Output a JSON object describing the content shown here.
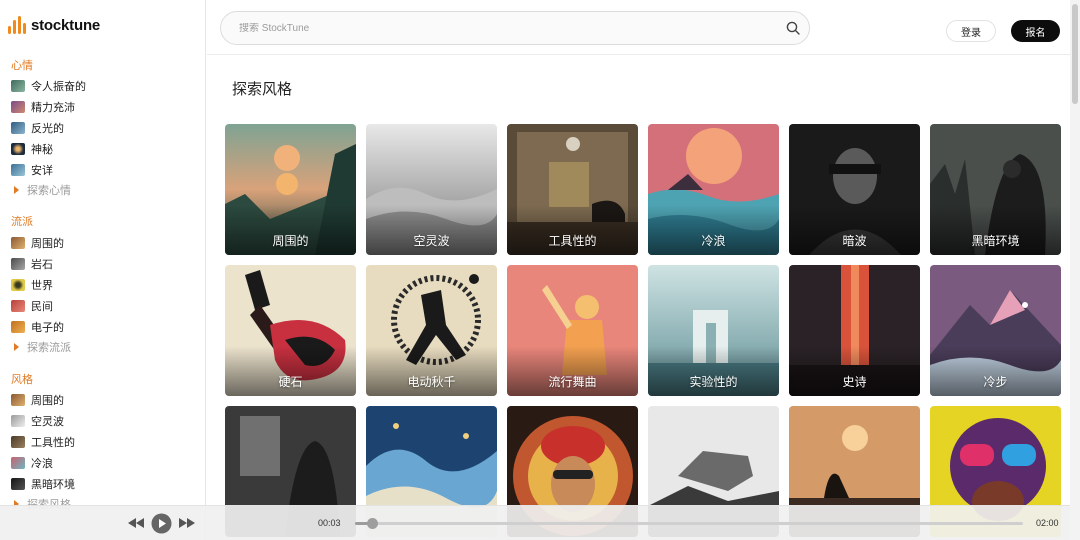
{
  "app": {
    "brand": "stocktune"
  },
  "sidebar": {
    "sections": [
      {
        "title": "心情",
        "items": [
          {
            "label": "令人振奋的",
            "thumb": "#5c8a7a"
          },
          {
            "label": "精力充沛",
            "thumb": "#b06c7c"
          },
          {
            "label": "反光的",
            "thumb": "#4f7c9c"
          },
          {
            "label": "神秘",
            "thumb": "#2b3c53"
          },
          {
            "label": "安详",
            "thumb": "#5d8dab"
          }
        ],
        "explore": "探索心情"
      },
      {
        "title": "流派",
        "items": [
          {
            "label": "周围的",
            "thumb": "#a7794e"
          },
          {
            "label": "岩石",
            "thumb": "#6f6f6f"
          },
          {
            "label": "世界",
            "thumb": "#c9b13a"
          },
          {
            "label": "民间",
            "thumb": "#c8504a"
          },
          {
            "label": "电子的",
            "thumb": "#d38a2e"
          }
        ],
        "explore": "探索流派"
      },
      {
        "title": "风格",
        "items": [
          {
            "label": "周围的",
            "thumb": "#a7794e"
          },
          {
            "label": "空灵波",
            "thumb": "#c7c7c7"
          },
          {
            "label": "工具性的",
            "thumb": "#6f5a40"
          },
          {
            "label": "冷浪",
            "thumb": "#c9707e"
          },
          {
            "label": "黑暗环境",
            "thumb": "#2c2c2c"
          }
        ],
        "explore": "探索风格"
      }
    ]
  },
  "header": {
    "search_placeholder": "搜索 StockTune",
    "login_label": "登录",
    "signup_label": "报名"
  },
  "main": {
    "title": "探索风格",
    "cards": [
      {
        "label": "周围的"
      },
      {
        "label": "空灵波"
      },
      {
        "label": "工具性的"
      },
      {
        "label": "冷浪"
      },
      {
        "label": "暗波"
      },
      {
        "label": "黑暗环境"
      },
      {
        "label": "硬石"
      },
      {
        "label": "电动秋千"
      },
      {
        "label": "流行舞曲"
      },
      {
        "label": "实验性的"
      },
      {
        "label": "史诗"
      },
      {
        "label": "冷步"
      },
      {
        "label": ""
      },
      {
        "label": ""
      },
      {
        "label": ""
      },
      {
        "label": ""
      },
      {
        "label": ""
      },
      {
        "label": ""
      }
    ]
  },
  "player": {
    "current_time": "00:03",
    "total_time": "02:00",
    "progress": 0.025
  },
  "colors": {
    "accent": "#e07a24",
    "dark": "#0c0c0c"
  }
}
